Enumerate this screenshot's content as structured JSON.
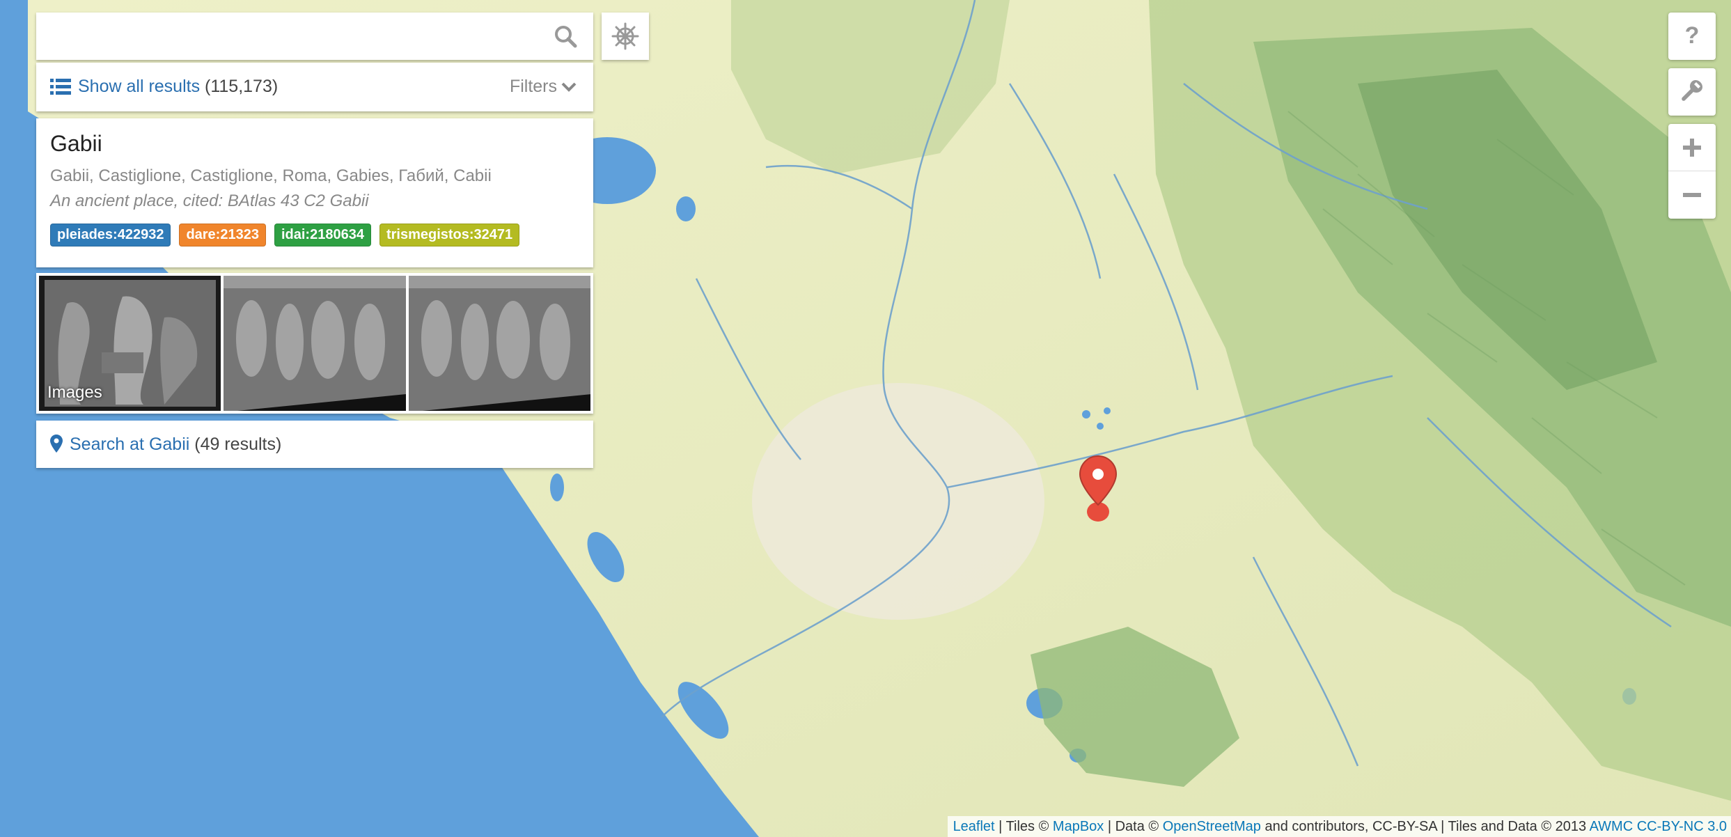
{
  "search": {
    "value": "",
    "placeholder": ""
  },
  "results_bar": {
    "show_all_label": "Show all results",
    "count": "(115,173)",
    "filters_label": "Filters"
  },
  "place": {
    "name": "Gabii",
    "alt_names": "Gabii, Castiglione, Castiglione, Roma, Gabies, Габий, Cabii",
    "description": "An ancient place, cited: BAtlas 43 C2 Gabii",
    "tags": [
      {
        "label": "pleiades:422932",
        "color": "#2f7bb8"
      },
      {
        "label": "dare:21323",
        "color": "#f0852c"
      },
      {
        "label": "idai:2180634",
        "color": "#2ea043"
      },
      {
        "label": "trismegistos:32471",
        "color": "#b4bb22"
      }
    ]
  },
  "images": {
    "label": "Images",
    "count": 3
  },
  "search_at": {
    "link_label": "Search at Gabii",
    "count": "(49 results)"
  },
  "controls": {
    "help_icon": "question-icon",
    "tools_icon": "wrench-icon",
    "zoom_in": "+",
    "zoom_out": "−",
    "settings_icon": "ship-wheel-icon"
  },
  "attribution": {
    "leaflet": "Leaflet",
    "sep1": " | Tiles © ",
    "mapbox": "MapBox",
    "sep2": " | Data © ",
    "osm": "OpenStreetMap",
    "sep3": " and contributors, CC-BY-SA | Tiles and Data © 2013 ",
    "awmc": "AWMC CC-BY-NC 3.0"
  },
  "colors": {
    "sea": "#5fa0db",
    "land": "#e6eac0",
    "hills": "#8fb877",
    "accent": "#2a6fb0",
    "marker": "#e74c3c"
  }
}
